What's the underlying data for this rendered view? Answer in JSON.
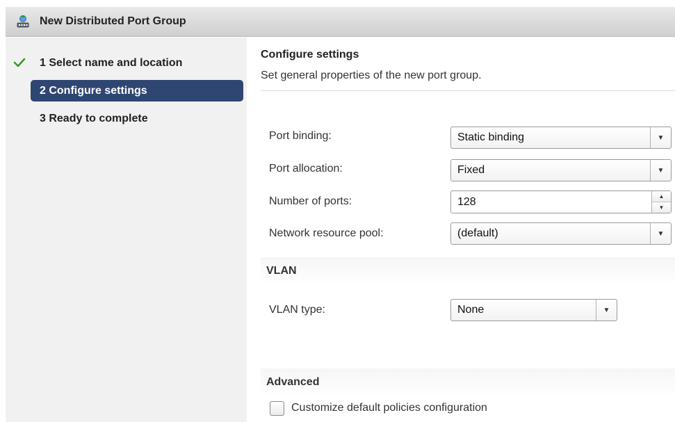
{
  "window": {
    "title": "New Distributed Port Group"
  },
  "nav": {
    "steps": [
      {
        "label": "1  Select name and location",
        "state": "done"
      },
      {
        "label": "2  Configure settings",
        "state": "active"
      },
      {
        "label": "3  Ready to complete",
        "state": "pending"
      }
    ]
  },
  "header": {
    "title": "Configure settings",
    "subtitle": "Set general properties of the new port group."
  },
  "form": {
    "port_binding": {
      "label": "Port binding:",
      "value": "Static binding"
    },
    "port_allocation": {
      "label": "Port allocation:",
      "value": "Fixed"
    },
    "number_of_ports": {
      "label": "Number of ports:",
      "value": "128"
    },
    "network_resource_pool": {
      "label": "Network resource pool:",
      "value": "(default)"
    }
  },
  "vlan": {
    "section_title": "VLAN",
    "type": {
      "label": "VLAN type:",
      "value": "None"
    }
  },
  "advanced": {
    "section_title": "Advanced",
    "customize": {
      "label": "Customize default policies configuration",
      "checked": false
    }
  },
  "colors": {
    "active_step_bg": "#2f4672",
    "check_green": "#3a9a2a",
    "nav_bg": "#f1f1f1"
  },
  "icons": {
    "title": "distributed-port-group-icon",
    "done_step": "checkmark-icon",
    "dropdown": "chevron-down-icon",
    "spinner_up": "arrow-up-icon",
    "spinner_down": "arrow-down-icon"
  }
}
